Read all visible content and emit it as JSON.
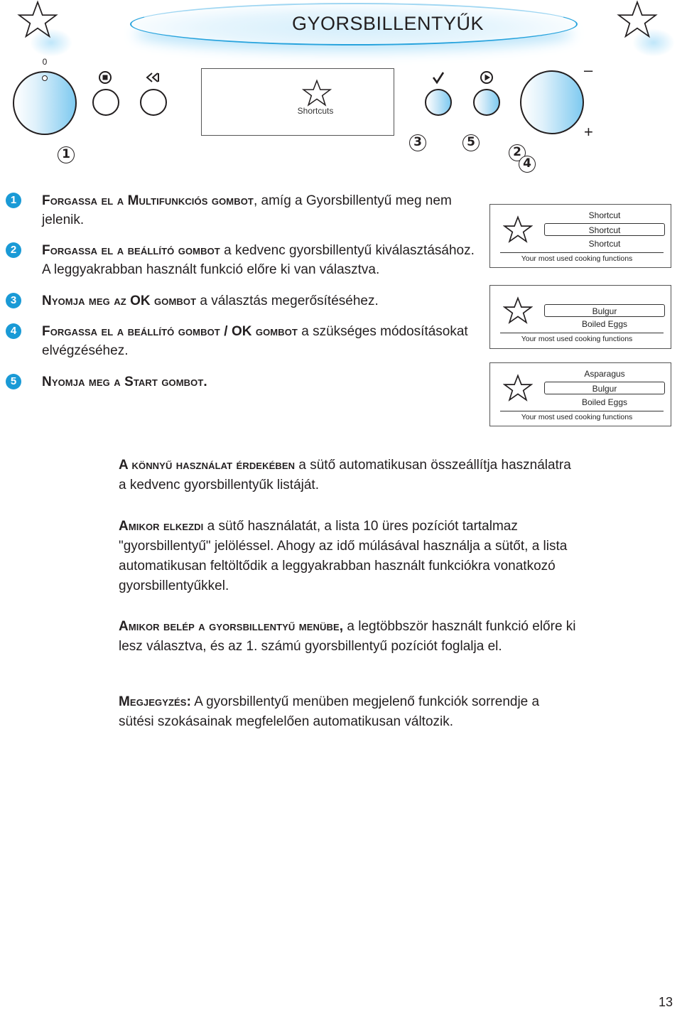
{
  "header": {
    "title": "GYORSBILLENTYŰK",
    "accent_color": "#27a3dd"
  },
  "control_panel": {
    "knob_left_label": "0",
    "stop_icon": "stop-circle-icon",
    "back_icon": "rewind-icon",
    "ok_icon": "checkmark-icon",
    "start_icon": "play-circle-icon",
    "knob_right_minus": "–",
    "knob_right_plus": "+",
    "display_label": "Shortcuts",
    "callouts": [
      "1",
      "3",
      "5",
      "2",
      "4"
    ]
  },
  "steps": [
    {
      "num": "1",
      "bold": "Forgassa el a Multifunkciós gombot",
      "text": ", amíg a Gyorsbillentyű meg nem jelenik."
    },
    {
      "num": "2",
      "bold": "Forgassa el a beállító gombot",
      "text": " a kedvenc gyorsbillentyű kiválasztásához. A leggyakrabban használt funkció előre ki van választva."
    },
    {
      "num": "3",
      "bold1": "Nyomja meg az ",
      "ok": "OK",
      "bold2": " gombot",
      "text": " a választás megerősítéséhez."
    },
    {
      "num": "4",
      "bold1": "Forgassa el a beállító gombot / ",
      "ok": "OK",
      "bold2": " gombot",
      "text": " a szükséges módosításokat elvégzéséhez."
    },
    {
      "num": "5",
      "bold": "Nyomja meg a Start gombot.",
      "text": ""
    }
  ],
  "screens": [
    {
      "rows": [
        "Shortcut",
        "Shortcut",
        "Shortcut"
      ],
      "selected_index": 1,
      "footer": "Your most used cooking functions"
    },
    {
      "rows": [
        "Bulgur",
        "Boiled Eggs"
      ],
      "selected_index": 0,
      "footer": "Your most used cooking functions"
    },
    {
      "rows": [
        "Asparagus",
        "Bulgur",
        "Boiled Eggs"
      ],
      "selected_index": 1,
      "footer": "Your most used cooking functions"
    }
  ],
  "paragraphs": [
    {
      "bold": "A könnyű használat érdekében",
      "text": " a sütő automatikusan összeállítja használatra a kedvenc gyorsbillentyűk listáját."
    },
    {
      "bold": "Amikor elkezdi",
      "text": " a sütő használatát, a lista 10 üres pozíciót tartalmaz \"gyorsbillentyű\" jelöléssel. Ahogy az idő múlásával használja a sütőt, a lista automatikusan feltöltődik a leggyakrabban használt funkciókra vonatkozó gyorsbillentyűkkel."
    },
    {
      "bold": "Amikor belép a gyorsbillentyű menübe,",
      "text": " a legtöbbször használt funkció előre ki lesz választva, és az 1. számú gyorsbillentyű pozíciót foglalja el."
    },
    {
      "bold": "Megjegyzés:",
      "text": " A gyorsbillentyű menüben megjelenő funkciók sorrendje a sütési szokásainak megfelelően automatikusan változik."
    }
  ],
  "page_number": "13"
}
